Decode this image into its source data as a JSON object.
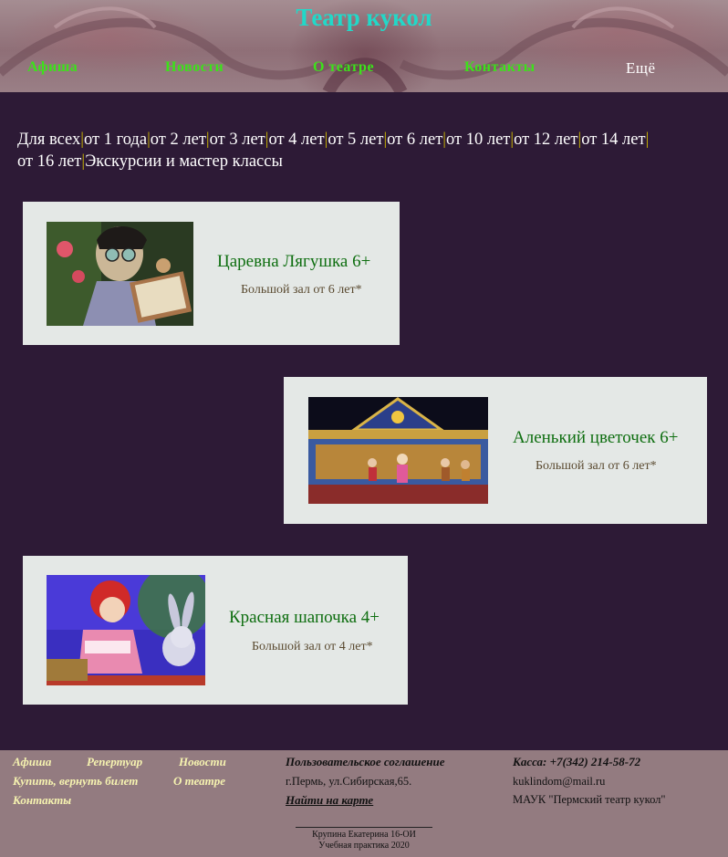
{
  "header": {
    "title": "Театр кукол",
    "nav": [
      "Афиша",
      "Новости",
      "О театре",
      "Контакты"
    ],
    "more_label": "Ещё"
  },
  "ages": {
    "filters": [
      "Для всех",
      "от 1 года",
      "от 2 лет",
      "от 3 лет",
      "от 4 лет",
      "от 5 лет",
      "от 6 лет",
      "от 10 лет",
      "от 12 лет",
      "от 14 лет",
      "от 16 лет",
      "Экскурсии и мастер классы"
    ]
  },
  "shows": [
    {
      "title": "Царевна Лягушка 6+",
      "hall": "Большой зал от 6 лет*"
    },
    {
      "title": "Аленький цветочек 6+",
      "hall": "Большой зал от 6 лет*"
    },
    {
      "title": "Красная шапочка 4+",
      "hall": "Большой зал от 4 лет*"
    }
  ],
  "footer": {
    "links": [
      "Афиша",
      "Репертуар",
      "Новости",
      "Купить, вернуть билет",
      "О театре",
      "Контакты"
    ],
    "agreement": "Пользовательское соглашение",
    "address": "г.Пермь, ул.Сибирская,65.",
    "map_link": "Найти на карте",
    "phone": "Касса: +7(342) 214-58-72",
    "email": "kuklindom@mail.ru",
    "org": "МАУК \"Пермский театр кукол\"",
    "credit_author": "Крупина Екатерина 16-ОИ",
    "credit_course": "Учебная практика 2020"
  },
  "colors": {
    "background": "#2d1a36",
    "title": "#22d8c8",
    "nav": "#3ce21a",
    "card": "#e4e8e6",
    "show_title": "#0e6e10",
    "footer": "#937b80",
    "footer_link": "#f6f3b0"
  }
}
